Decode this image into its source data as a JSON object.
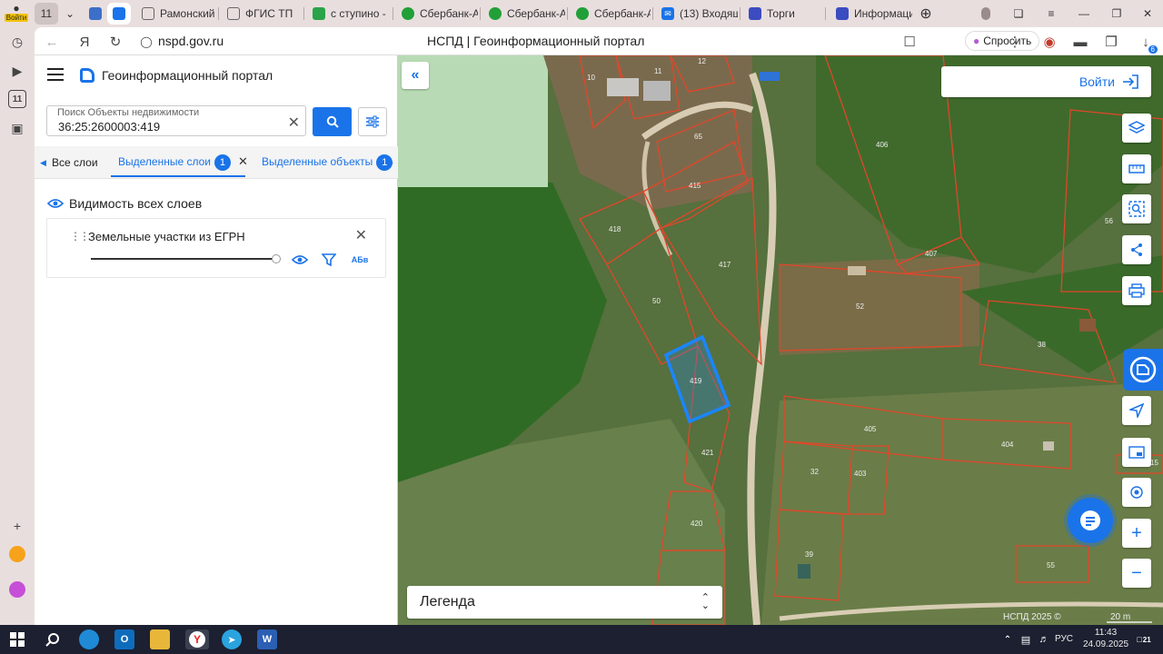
{
  "browser": {
    "profile_label": "Войти",
    "tab_count": "11",
    "tabs": [
      {
        "label": "Рамонский",
        "color": "#ffffff"
      },
      {
        "label": "ФГИС ТП",
        "color": "#ffffff"
      },
      {
        "label": "с ступино -",
        "color": "#2aa34a"
      },
      {
        "label": "Сбербанк-А",
        "color": "#21a038"
      },
      {
        "label": "Сбербанк-А",
        "color": "#21a038"
      },
      {
        "label": "Сбербанк-А",
        "color": "#21a038"
      },
      {
        "label": "(13) Входящ",
        "color": "#1a73e8"
      },
      {
        "label": "Торги",
        "color": "#3b4cc0"
      },
      {
        "label": "Информаци",
        "color": "#3b4cc0"
      }
    ],
    "sidebar_badge": "11",
    "url": "nspd.gov.ru",
    "page_title": "НСПД | Геоинформационный портал",
    "ask_button": "Спросить",
    "downloads_badge": "6"
  },
  "panel": {
    "portal_title": "Геоинформационный портал",
    "search": {
      "placeholder": "Поиск Объекты недвижимости",
      "value": "36:25:2600003:419"
    },
    "tabs": [
      {
        "label": "Все слои"
      },
      {
        "label": "Выделенные слои",
        "badge": "1"
      },
      {
        "label": "Выделенные объекты",
        "badge": "1"
      }
    ],
    "visibility_label": "Видимость всех слоев",
    "layer": {
      "name": "Земельные участки из ЕГРН",
      "opacity": 1.0,
      "label_icon_text": "АБв"
    }
  },
  "map": {
    "login_label": "Войти",
    "legend_label": "Легенда",
    "copyright": "НСПД 2025 ©",
    "scale_label": "20 m",
    "parcel_labels": [
      "10",
      "11",
      "12",
      "65",
      "415",
      "418",
      "417",
      "50",
      "419",
      "421",
      "420",
      "406",
      "407",
      "52",
      "56",
      "38",
      "405",
      "404",
      "32",
      "403",
      "39",
      "55",
      "15"
    ],
    "selected_parcel": "419",
    "colors": {
      "accent": "#1a73e8",
      "parcel_outline": "#e2462a",
      "selected_outline": "#1a86ff"
    }
  },
  "taskbar": {
    "language": "РУС",
    "time": "11:43",
    "date": "24.09.2025",
    "notifications": "21"
  }
}
